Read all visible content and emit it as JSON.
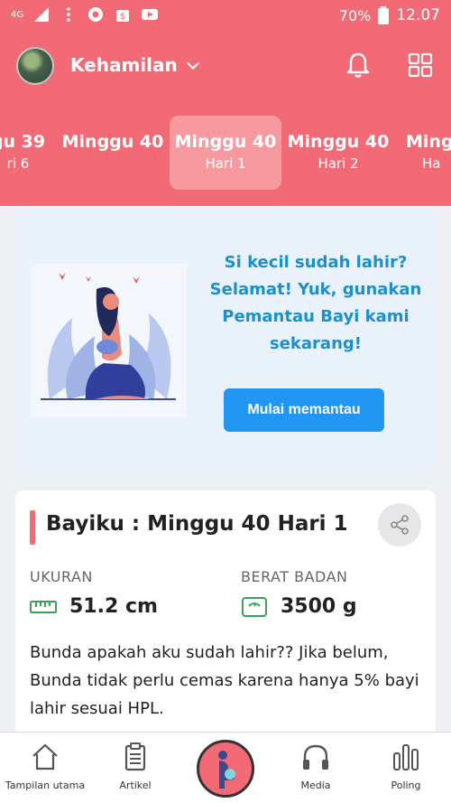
{
  "status_bar": {
    "network": "4G",
    "battery": "70%",
    "time": "12.07"
  },
  "header": {
    "title": "Kehamilan"
  },
  "weeks": [
    {
      "week": "gu 39",
      "day": "ri 6"
    },
    {
      "week": "Minggu 40",
      "day": ""
    },
    {
      "week": "Minggu 40",
      "day": "Hari 1"
    },
    {
      "week": "Minggu 40",
      "day": "Hari 2"
    },
    {
      "week": "Mingg",
      "day": "Ha"
    }
  ],
  "promo": {
    "text": "Si kecil sudah lahir? Selamat! Yuk, gunakan Pemantau Bayi kami sekarang!",
    "button": "Mulai memantau"
  },
  "info": {
    "title": "Bayiku : Minggu 40 Hari 1",
    "size_label": "UKURAN",
    "size_value": "51.2 cm",
    "weight_label": "BERAT BADAN",
    "weight_value": "3500 g",
    "description": "Bunda apakah aku sudah lahir?? Jika belum, Bunda tidak perlu cemas karena hanya 5% bayi lahir sesuai HPL."
  },
  "nav": {
    "home": "Tampilan utama",
    "articles": "Artikel",
    "media": "Media",
    "poll": "Poling"
  },
  "colors": {
    "brand": "#f26a75",
    "accent_blue": "#2196f3",
    "promo_text": "#1d8fce"
  }
}
